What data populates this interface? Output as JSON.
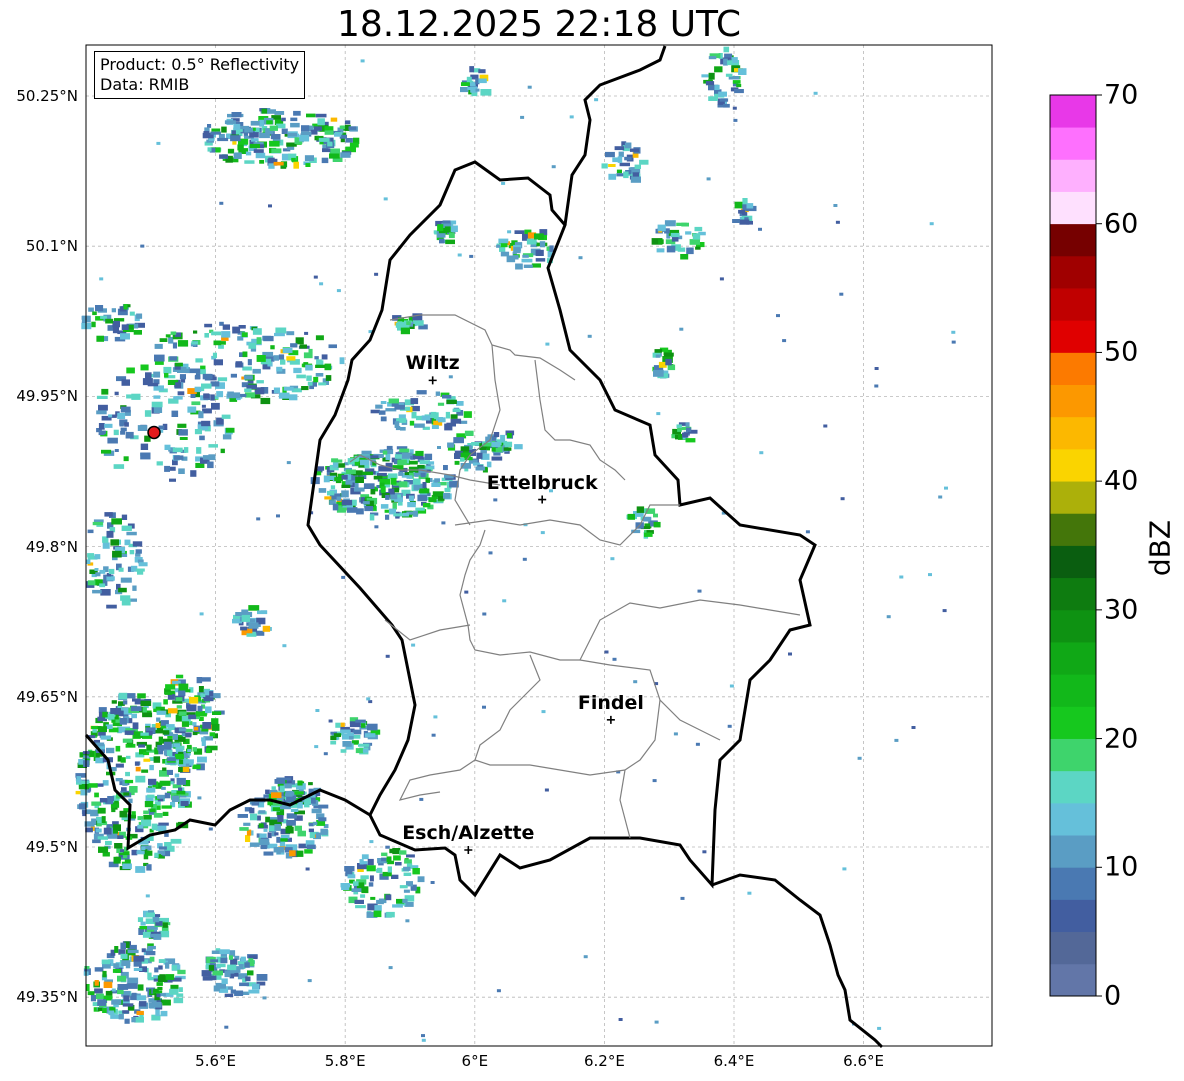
{
  "title": "18.12.2025 22:18 UTC",
  "info": {
    "product": "Product: 0.5° Reflectivity",
    "data": "Data: RMIB"
  },
  "lon_ticks": [
    "5.6°E",
    "5.8°E",
    "6°E",
    "6.2°E",
    "6.4°E",
    "6.6°E"
  ],
  "lat_ticks": [
    "50.25°N",
    "50.1°N",
    "49.95°N",
    "49.8°N",
    "49.65°N",
    "49.5°N",
    "49.35°N"
  ],
  "cities": [
    {
      "name": "Wiltz",
      "lon": 5.935,
      "lat": 49.966
    },
    {
      "name": "Ettelbruck",
      "lon": 6.104,
      "lat": 49.847
    },
    {
      "name": "Findel",
      "lon": 6.21,
      "lat": 49.627
    },
    {
      "name": "Esch/Alzette",
      "lon": 5.99,
      "lat": 49.497
    }
  ],
  "radar_site": {
    "lon": 5.505,
    "lat": 49.914,
    "color": "#e41a1c"
  },
  "colorbar": {
    "label": "dBZ",
    "ticks": [
      "0",
      "10",
      "20",
      "30",
      "40",
      "50",
      "60",
      "70"
    ],
    "colors": [
      "#6276a8",
      "#536898",
      "#425ea0",
      "#4a79b2",
      "#5a9dc4",
      "#65c0da",
      "#5cd6c4",
      "#3ed46c",
      "#16c81e",
      "#12b81a",
      "#10a816",
      "#0e9212",
      "#0e7c10",
      "#0a5e10",
      "#44760a",
      "#acb00a",
      "#fad400",
      "#fcb800",
      "#fc9800",
      "#fc7a00",
      "#e00000",
      "#c00000",
      "#a00000",
      "#760000",
      "#fee0fe",
      "#feb0fe",
      "#fe70fe",
      "#e838e8"
    ]
  }
}
